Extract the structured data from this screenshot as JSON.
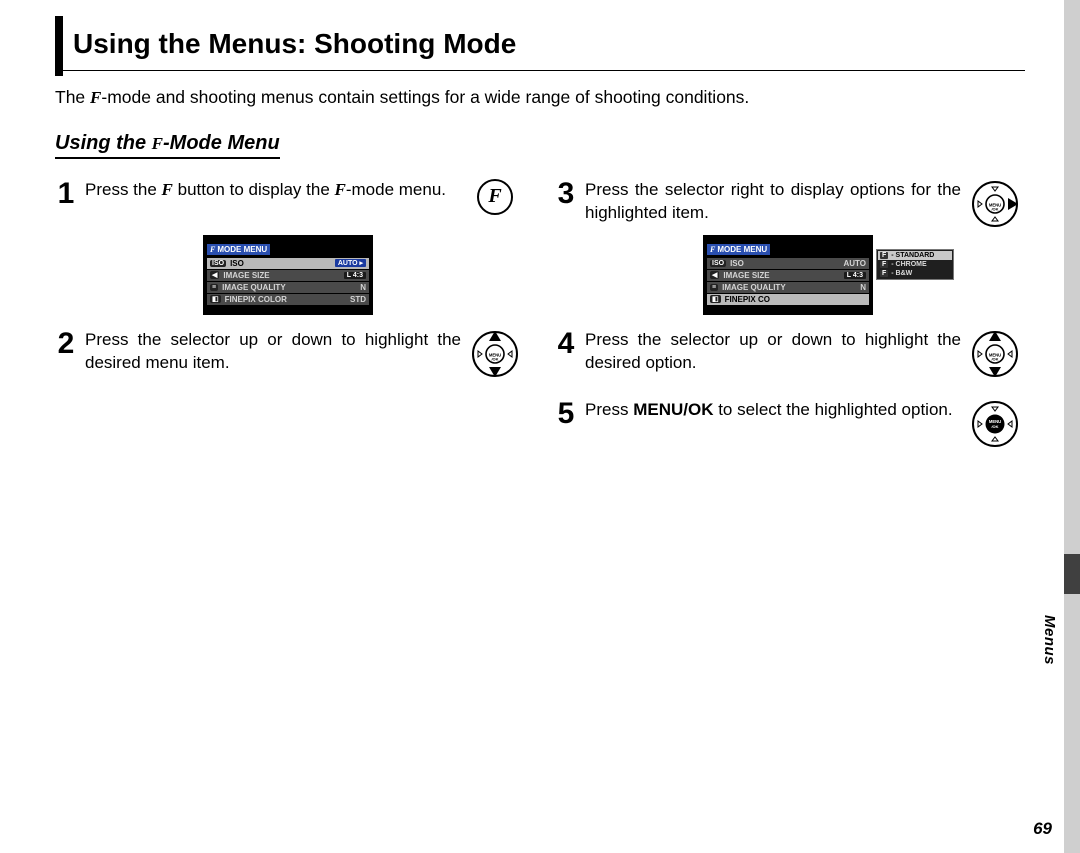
{
  "title": "Using the Menus: Shooting Mode",
  "glyph": {
    "f": "F"
  },
  "intro": {
    "before": "The ",
    "after": "-mode and shooting menus contain settings for a wide range of shooting conditions."
  },
  "subhead": {
    "before": "Using the ",
    "after": "-Mode Menu"
  },
  "steps": [
    {
      "num": "1",
      "text_a": "Press the ",
      "text_b": " button to display the ",
      "text_c": "-mode menu."
    },
    {
      "num": "2",
      "text": "Press the selector up or down to highlight the desired menu item."
    },
    {
      "num": "3",
      "text": "Press the selector right to display options for the highlighted item."
    },
    {
      "num": "4",
      "text": "Press the selector up or down to highlight the desired option."
    },
    {
      "num": "5",
      "text_a": "Press ",
      "text_bold": "MENU/OK",
      "text_b": " to select the high­lighted option."
    }
  ],
  "mock1": {
    "title": "MODE MENU",
    "rows": [
      {
        "icon": "ISO",
        "label": "ISO",
        "value": "AUTO ▸"
      },
      {
        "icon": "◀",
        "label": "IMAGE SIZE",
        "value": "L 4:3"
      },
      {
        "icon": "≡",
        "label": "IMAGE QUALITY",
        "value": "N"
      },
      {
        "icon": "◧",
        "label": "FINEPIX COLOR",
        "value": "STD"
      }
    ]
  },
  "mock2": {
    "title": "MODE MENU",
    "rows": [
      {
        "icon": "ISO",
        "label": "ISO",
        "value": "AUTO"
      },
      {
        "icon": "◀",
        "label": "IMAGE SIZE",
        "value": "L 4:3"
      },
      {
        "icon": "≡",
        "label": "IMAGE QUALITY",
        "value": "N"
      },
      {
        "icon": "◧",
        "label": "FINEPIX CO",
        "value": ""
      }
    ],
    "popup": [
      "- STANDARD",
      "- CHROME",
      "- B&W"
    ]
  },
  "side_label": "Menus",
  "page_number": "69"
}
